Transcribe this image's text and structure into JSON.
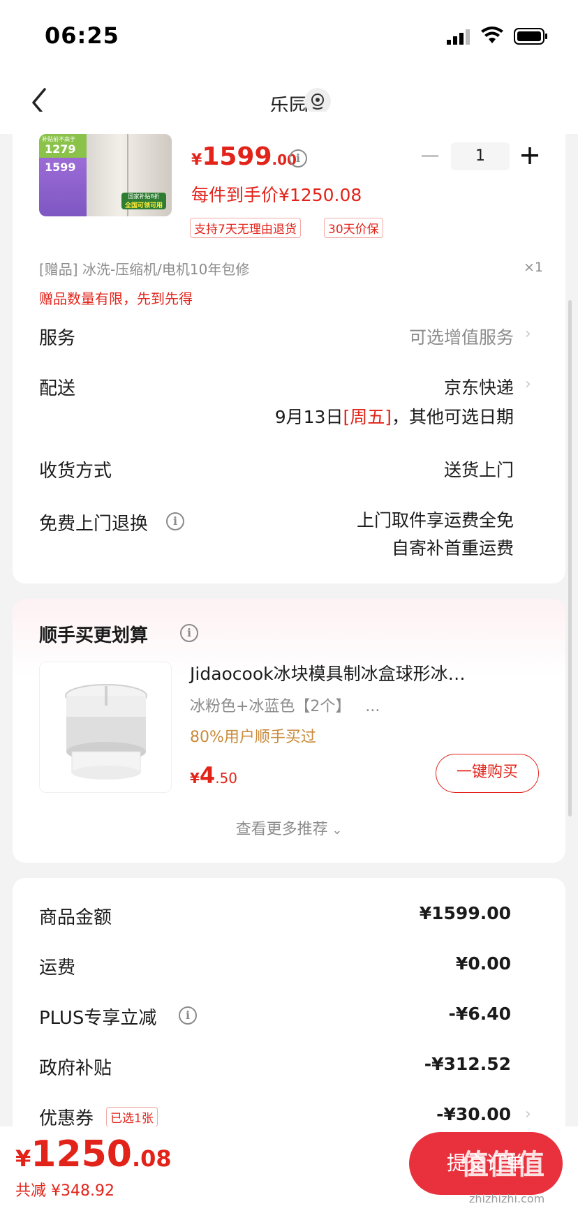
{
  "status_bar": {
    "time": "06:25"
  },
  "nav": {
    "title": "乐园"
  },
  "product": {
    "price_symbol": "¥",
    "price_int": "1599",
    "price_dec": ".00",
    "quantity": "1",
    "final_price_text": "每件到手价¥1250.08",
    "tags": [
      "支持7天无理由退货",
      "30天价保"
    ],
    "img_badges": [
      "补贴前不高于",
      "1279",
      "1599",
      "国家补贴8折",
      "全国可领可用"
    ]
  },
  "gift": {
    "text": "[赠品] 冰洗-压缩机/电机10年包修",
    "qty": "×1",
    "note": "赠品数量有限，先到先得"
  },
  "rows": {
    "service_label": "服务",
    "service_value": "可选增值服务",
    "delivery_label": "配送",
    "delivery_value": "京东快递",
    "delivery_date": "9月13日",
    "delivery_weekday": "[周五]",
    "delivery_more": "，其他可选日期",
    "receive_label": "收货方式",
    "receive_value": "送货上门",
    "return_label": "免费上门退换",
    "return_value_1": "上门取件享运费全免",
    "return_value_2": "自寄补首重运费"
  },
  "recommend": {
    "title": "顺手买更划算",
    "item_title": "Jidaocook冰块模具制冰盒球形冰…",
    "item_spec": "冰粉色+冰蓝色【2个】   ...",
    "item_stat": "80%用户顺手买过",
    "item_price_symbol": "¥",
    "item_price_int": "4",
    "item_price_dec": ".50",
    "buy_label": "一键购买",
    "more_label": "查看更多推荐"
  },
  "summary": {
    "goods_label": "商品金额",
    "goods_value": "¥1599.00",
    "shipping_label": "运费",
    "shipping_value": "¥0.00",
    "plus_label": "PLUS专享立减",
    "plus_value": "-¥6.40",
    "gov_label": "政府补贴",
    "gov_value": "-¥312.52",
    "coupon_label": "优惠券",
    "coupon_tag": "已选1张",
    "coupon_value": "-¥30.00"
  },
  "bottom": {
    "total_symbol": "¥",
    "total_int": "1250",
    "total_dec": ".08",
    "saved": "共减 ¥348.92",
    "submit_label": "提交订单"
  },
  "watermark": {
    "text": "值值值",
    "url": "zhizhizhi.com"
  },
  "colors": {
    "accent": "#e2231a",
    "button": "#e8313d",
    "stat": "#c98a3a"
  }
}
